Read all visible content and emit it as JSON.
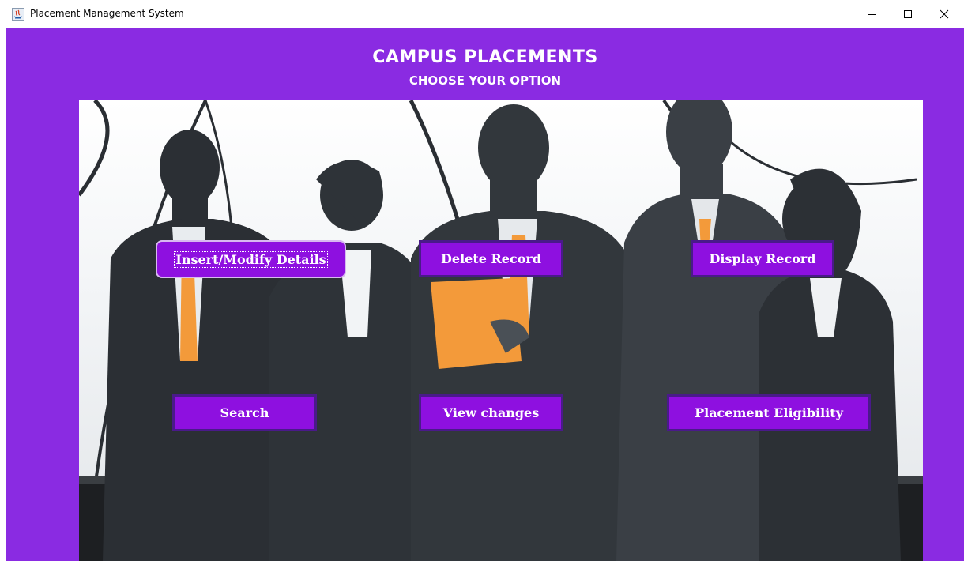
{
  "window": {
    "title": "Placement Management System",
    "controls": {
      "minimize": "minimize-icon",
      "maximize": "maximize-icon",
      "close": "close-icon"
    }
  },
  "header": {
    "title": "CAMPUS PLACEMENTS",
    "subtitle": "CHOOSE YOUR OPTION"
  },
  "buttons": {
    "insert_modify": "Insert/Modify Details",
    "delete_record": "Delete Record",
    "display_record": "Display Record",
    "search": "Search",
    "view_changes": "View changes",
    "placement_eligibility": "Placement Eligibility"
  },
  "colors": {
    "background": "#8a2be2",
    "button": "#8e10e0",
    "button_border": "#4a1a8a"
  }
}
